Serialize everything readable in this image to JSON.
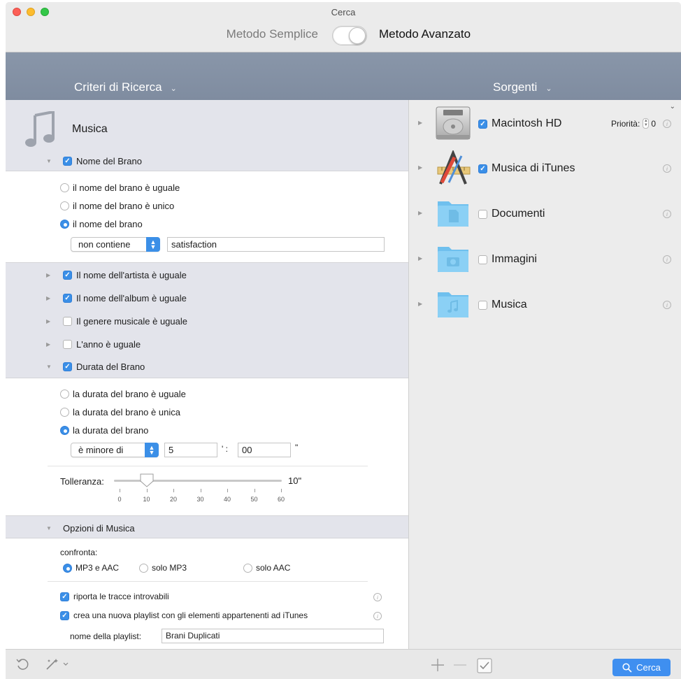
{
  "window": {
    "title": "Cerca"
  },
  "mode": {
    "simple": "Metodo Semplice",
    "advanced": "Metodo Avanzato"
  },
  "headers": {
    "criteria": "Criteri di Ricerca",
    "sources": "Sorgenti"
  },
  "left": {
    "category": "Musica",
    "song_name": {
      "label": "Nome del Brano",
      "options": [
        "il nome del brano è uguale",
        "il nome del brano è unico",
        "il nome del brano"
      ],
      "selected": 2,
      "condition": "non contiene",
      "value": "satisfaction"
    },
    "criteria": [
      {
        "label": "Il nome dell'artista è uguale",
        "checked": true
      },
      {
        "label": "Il nome dell'album è uguale",
        "checked": true
      },
      {
        "label": "Il genere musicale è uguale",
        "checked": false
      },
      {
        "label": "L'anno è uguale",
        "checked": false
      }
    ],
    "duration": {
      "label": "Durata del Brano",
      "options": [
        "la durata del brano è uguale",
        "la durata del brano è unica",
        "la durata del brano"
      ],
      "selected": 2,
      "condition": "è minore di",
      "minutes": "5",
      "seconds": "00",
      "min_sep": "' :",
      "sec_sep": "\"",
      "tolerance_label": "Tolleranza:",
      "tolerance_value": "10\"",
      "tolerance": 10,
      "ticks": [
        "0",
        "10",
        "20",
        "30",
        "40",
        "50",
        "60"
      ]
    },
    "music_options": {
      "label": "Opzioni di Musica",
      "compare_label": "confronta:",
      "compare": [
        "MP3 e AAC",
        "solo MP3",
        "solo AAC"
      ],
      "compare_selected": 0,
      "report_missing": "riporta le tracce introvabili",
      "create_playlist": "crea una nuova playlist con gli elementi appartenenti ad iTunes",
      "playlist_label": "nome della playlist:",
      "playlist_name": "Brani Duplicati"
    }
  },
  "sources": [
    {
      "label": "Macintosh HD",
      "checked": true,
      "icon": "hard-drive-icon"
    },
    {
      "label": "Musica di iTunes",
      "checked": true,
      "icon": "applications-icon"
    },
    {
      "label": "Documenti",
      "checked": false,
      "icon": "documents-folder-icon"
    },
    {
      "label": "Immagini",
      "checked": false,
      "icon": "pictures-folder-icon"
    },
    {
      "label": "Musica",
      "checked": false,
      "icon": "music-folder-icon"
    }
  ],
  "priority": {
    "label": "Priorità:",
    "value": "0"
  },
  "bottom": {
    "search": "Cerca"
  },
  "colors": {
    "accent": "#3b8fe7",
    "header": "#8592a6"
  }
}
